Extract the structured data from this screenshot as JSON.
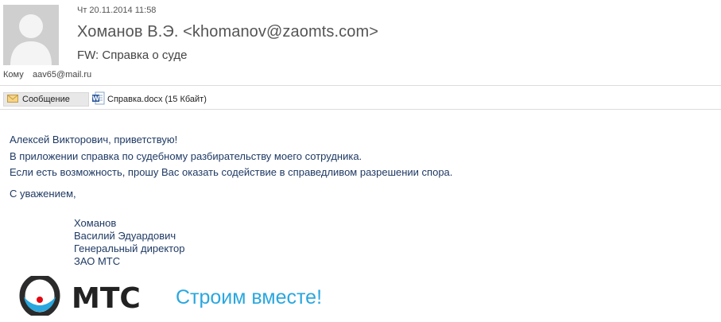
{
  "header": {
    "date": "Чт 20.11.2014 11:58",
    "from": "Хоманов В.Э. <khomanov@zaomts.com>",
    "subject": "FW: Справка о суде",
    "to_label": "Кому",
    "to_value": "aav65@mail.ru"
  },
  "tabs": {
    "message_label": "Сообщение",
    "attachment_label": "Справка.docx (15 Кбайт)"
  },
  "body": {
    "lines": [
      "Алексей Викторович, приветствую!",
      "В приложении справка по судебному разбирательству моего сотрудника.",
      "Если есть возможность, прошу Вас оказать содействие в справедливом разрешении спора."
    ],
    "regards": "С уважением,"
  },
  "signature": {
    "surname": "Хоманов",
    "given_names": "Василий Эдуардович",
    "position": "Генеральный директор",
    "company": "ЗАО МТС"
  },
  "logo": {
    "brand": "МТС",
    "slogan": "Строим вместе!",
    "colors": {
      "brand_red": "#e30611",
      "slogan_blue": "#2aa7df",
      "egg_blue": "#29a8e0"
    }
  },
  "icons": {
    "avatar": "person-silhouette-icon",
    "message_tab": "envelope-icon",
    "attachment": "word-document-icon"
  }
}
